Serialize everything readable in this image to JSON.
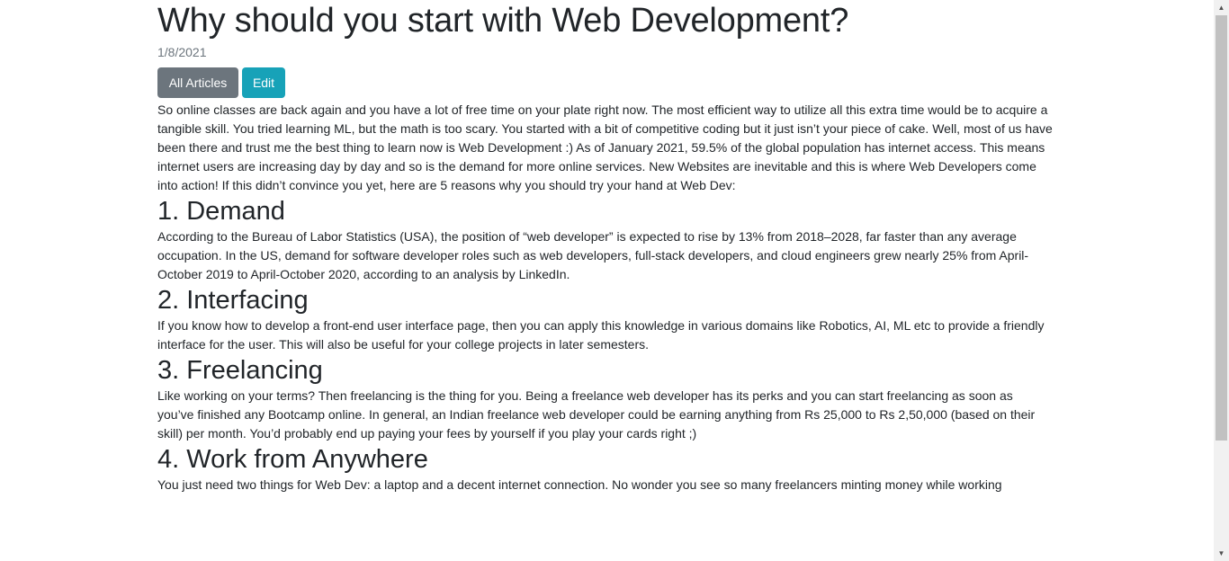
{
  "article": {
    "title": "Why should you start with Web Development?",
    "date": "1/8/2021",
    "intro": "So online classes are back again and you have a lot of free time on your plate right now. The most efficient way to utilize all this extra time would be to acquire a tangible skill. You tried learning ML, but the math is too scary. You started with a bit of competitive coding but it just isn’t your piece of cake. Well, most of us have been there and trust me the best thing to learn now is Web Development :) As of January 2021, 59.5% of the global population has internet access. This means internet users are increasing day by day and so is the demand for more online services. New Websites are inevitable and this is where Web Developers come into action! If this didn’t convince you yet, here are 5 reasons why you should try your hand at Web Dev:",
    "sections": [
      {
        "heading": "1. Demand",
        "body": "According to the Bureau of Labor Statistics (USA), the position of “web developer” is expected to rise by 13% from 2018–2028, far faster than any average occupation. In the US, demand for software developer roles such as web developers, full-stack developers, and cloud engineers grew nearly 25% from April-October 2019 to April-October 2020, according to an analysis by LinkedIn."
      },
      {
        "heading": "2. Interfacing",
        "body": "If you know how to develop a front-end user interface page, then you can apply this knowledge in various domains like Robotics, AI, ML etc to provide a friendly interface for the user. This will also be useful for your college projects in later semesters."
      },
      {
        "heading": "3. Freelancing",
        "body": "Like working on your terms? Then freelancing is the thing for you. Being a freelance web developer has its perks and you can start freelancing as soon as you’ve finished any Bootcamp online. In general, an Indian freelance web developer could be earning anything from Rs 25,000 to Rs 2,50,000 (based on their skill) per month. You’d probably end up paying your fees by yourself if you play your cards right ;)"
      },
      {
        "heading": "4. Work from Anywhere",
        "body": "You just need two things for Web Dev: a laptop and a decent internet connection. No wonder you see so many freelancers minting money while working"
      }
    ]
  },
  "buttons": {
    "all_articles": "All Articles",
    "edit": "Edit"
  },
  "colors": {
    "secondary": "#6c757d",
    "info": "#17a2b8",
    "text": "#212529"
  }
}
